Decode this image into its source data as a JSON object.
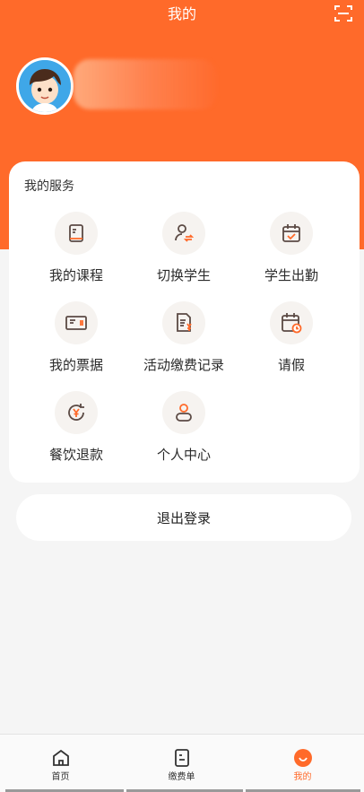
{
  "header": {
    "title": "我的"
  },
  "services": {
    "title": "我的服务",
    "items": [
      {
        "label": "我的课程",
        "icon": "course-book-icon"
      },
      {
        "label": "切换学生",
        "icon": "switch-student-icon"
      },
      {
        "label": "学生出勤",
        "icon": "attendance-calendar-icon"
      },
      {
        "label": "我的票据",
        "icon": "ticket-icon"
      },
      {
        "label": "活动缴费记录",
        "icon": "payment-record-icon"
      },
      {
        "label": "请假",
        "icon": "leave-calendar-icon"
      },
      {
        "label": "餐饮退款",
        "icon": "refund-icon"
      },
      {
        "label": "个人中心",
        "icon": "person-icon"
      }
    ]
  },
  "logout": {
    "label": "退出登录"
  },
  "tabbar": {
    "items": [
      {
        "label": "首页",
        "icon": "home-icon",
        "active": false
      },
      {
        "label": "缴费单",
        "icon": "bill-icon",
        "active": false
      },
      {
        "label": "我的",
        "icon": "profile-icon",
        "active": true
      }
    ]
  },
  "colors": {
    "accent": "#ff6a2a",
    "icon_stroke": "#5b4a44"
  }
}
